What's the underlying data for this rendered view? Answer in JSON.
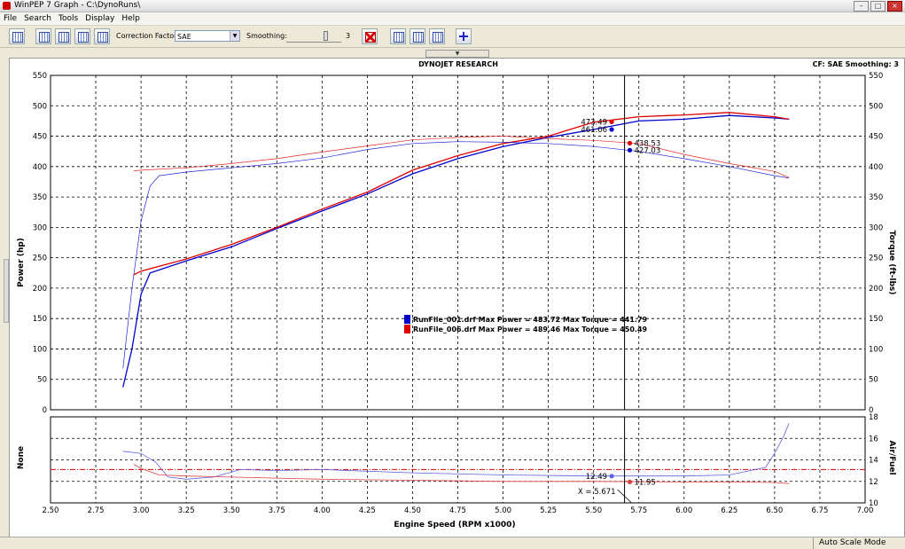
{
  "window": {
    "title": "WinPEP 7    Graph - C:\\DynoRuns\\"
  },
  "menu": [
    "File",
    "Search",
    "Tools",
    "Display",
    "Help"
  ],
  "toolbar": {
    "correction_label": "Correction Factor:",
    "correction_value": "SAE",
    "smoothing_label": "Smoothing:",
    "smoothing_value": "3"
  },
  "status": {
    "text": "Auto Scale Mode"
  },
  "colors": {
    "run1": "#0000cc",
    "run2": "#dd0000",
    "grid": "#000000"
  },
  "chart_data": {
    "type": "line",
    "title": "DYNOJET RESEARCH",
    "subtitle": "CF: SAE  Smoothing: 3",
    "xlabel": "Engine Speed (RPM x1000)",
    "ylabel_left": "Power (hp)",
    "ylabel_right": "Torque (ft-lbs)",
    "xlim": [
      2.5,
      7.0
    ],
    "ylim": [
      0,
      550
    ],
    "x_ticks": [
      "2.50",
      "2.75",
      "3.00",
      "3.25",
      "3.50",
      "3.75",
      "4.00",
      "4.25",
      "4.50",
      "4.75",
      "5.00",
      "5.25",
      "5.50",
      "5.75",
      "6.00",
      "6.25",
      "6.50",
      "6.75",
      "7.00"
    ],
    "y_ticks": [
      "0",
      "50",
      "100",
      "150",
      "200",
      "250",
      "300",
      "350",
      "400",
      "450",
      "500",
      "550"
    ],
    "cursor_x": 5.671,
    "cursor_label": "X = 5.671",
    "legend": [
      {
        "text": "RunFile_001.drf Max Power = 483.72 Max Torque = 441.79",
        "color": "#0000cc"
      },
      {
        "text": "RunFile_006.drf Max Power = 489.46 Max Torque = 450.49",
        "color": "#dd0000"
      }
    ],
    "series": [
      {
        "name": "RunFile_001.drf",
        "kind": "power",
        "color": "#0000cc",
        "x": [
          2.9,
          2.95,
          3.0,
          3.05,
          3.25,
          3.5,
          3.75,
          4.0,
          4.25,
          4.5,
          4.75,
          5.0,
          5.25,
          5.5,
          5.75,
          6.0,
          6.25,
          6.5,
          6.58
        ],
        "y": [
          37,
          100,
          190,
          225,
          245,
          268,
          298,
          327,
          355,
          388,
          413,
          433,
          448,
          461,
          475,
          478,
          484,
          480,
          478
        ]
      },
      {
        "name": "RunFile_006.drf",
        "kind": "power",
        "color": "#dd0000",
        "x": [
          2.96,
          3.0,
          3.25,
          3.5,
          3.75,
          4.0,
          4.25,
          4.5,
          4.75,
          5.0,
          5.25,
          5.5,
          5.75,
          6.0,
          6.25,
          6.5,
          6.58
        ],
        "y": [
          222,
          228,
          248,
          272,
          300,
          330,
          358,
          394,
          418,
          438,
          450,
          473,
          482,
          485,
          489,
          482,
          478
        ]
      },
      {
        "name": "RunFile_001.drf",
        "kind": "torque",
        "color": "#0000cc",
        "x": [
          2.9,
          2.95,
          3.0,
          3.05,
          3.1,
          3.25,
          3.5,
          3.75,
          4.0,
          4.25,
          4.5,
          4.75,
          5.0,
          5.25,
          5.5,
          5.75,
          6.0,
          6.25,
          6.5,
          6.58
        ],
        "y": [
          68,
          200,
          310,
          368,
          385,
          391,
          398,
          405,
          414,
          428,
          438,
          441,
          440,
          438,
          433,
          425,
          413,
          400,
          385,
          381
        ]
      },
      {
        "name": "RunFile_006.drf",
        "kind": "torque",
        "color": "#dd0000",
        "x": [
          2.96,
          3.0,
          3.25,
          3.5,
          3.75,
          4.0,
          4.25,
          4.5,
          4.75,
          5.0,
          5.25,
          5.5,
          5.75,
          6.0,
          6.25,
          6.5,
          6.58
        ],
        "y": [
          393,
          394,
          398,
          405,
          413,
          424,
          434,
          444,
          448,
          450,
          446,
          443,
          438,
          420,
          405,
          392,
          382
        ]
      }
    ],
    "cursor_values": [
      {
        "label": "473.49",
        "x": 5.6,
        "y": 473.49,
        "color": "#dd0000",
        "side": "left"
      },
      {
        "label": "461.06",
        "x": 5.6,
        "y": 461.06,
        "color": "#0000cc",
        "side": "left"
      },
      {
        "label": "438.53",
        "x": 5.7,
        "y": 438.53,
        "color": "#dd0000",
        "side": "right"
      },
      {
        "label": "427.03",
        "x": 5.7,
        "y": 427.03,
        "color": "#0000cc",
        "side": "right"
      }
    ],
    "sub_chart": {
      "ylabel_left": "None",
      "ylabel_right": "Air/Fuel",
      "ylim": [
        10,
        18
      ],
      "y_ticks": [
        "10",
        "12",
        "14",
        "16",
        "18"
      ],
      "reference_line": 13.1,
      "series": [
        {
          "name": "RunFile_001.drf",
          "color": "#6060dd",
          "x": [
            2.9,
            3.0,
            3.08,
            3.15,
            3.25,
            3.4,
            3.55,
            3.75,
            4.0,
            4.5,
            5.0,
            5.5,
            6.0,
            6.25,
            6.45,
            6.5,
            6.55,
            6.58
          ],
          "y": [
            14.8,
            14.6,
            13.8,
            12.4,
            12.2,
            12.4,
            13.1,
            13.0,
            13.1,
            12.8,
            12.6,
            12.5,
            12.5,
            12.6,
            13.3,
            14.6,
            16.2,
            17.4
          ]
        },
        {
          "name": "RunFile_006.drf",
          "color": "#dd4444",
          "x": [
            2.96,
            3.0,
            3.1,
            3.25,
            3.5,
            3.75,
            4.0,
            4.5,
            5.0,
            5.5,
            6.0,
            6.25,
            6.5,
            6.58
          ],
          "y": [
            13.6,
            13.2,
            12.6,
            12.5,
            12.4,
            12.3,
            12.2,
            12.1,
            12.0,
            12.0,
            11.95,
            11.95,
            11.9,
            11.8
          ]
        }
      ],
      "cursor_values": [
        {
          "label": "12.49",
          "x": 5.6,
          "y": 12.49,
          "color": "#6060dd",
          "side": "left"
        },
        {
          "label": "11.95",
          "x": 5.7,
          "y": 11.95,
          "color": "#dd4444",
          "side": "right"
        }
      ]
    }
  }
}
